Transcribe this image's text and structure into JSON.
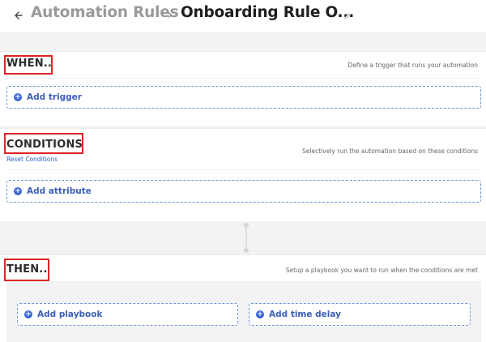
{
  "header": {
    "back_icon": "arrow-left-icon",
    "parent": "Automation Rules",
    "separator": "›",
    "current": "Onboarding Rule O...",
    "edit_icon": "pencil-icon"
  },
  "when": {
    "title": "WHEN..",
    "description": "Define a trigger that runs your automation",
    "add_label": "Add trigger"
  },
  "conditions": {
    "title": "CONDITIONS",
    "reset_label": "Reset Conditions",
    "description": "Selectively run the automation based on these conditions",
    "add_label": "Add attribute"
  },
  "then": {
    "title": "THEN..",
    "description": "Setup a playbook you want to run when the conditions are met",
    "add_playbook_label": "Add playbook",
    "add_delay_label": "Add time delay"
  },
  "colors": {
    "accent": "#3a67d6",
    "highlight_box": "#e02424",
    "canvas_bg": "#f3f3f5"
  }
}
